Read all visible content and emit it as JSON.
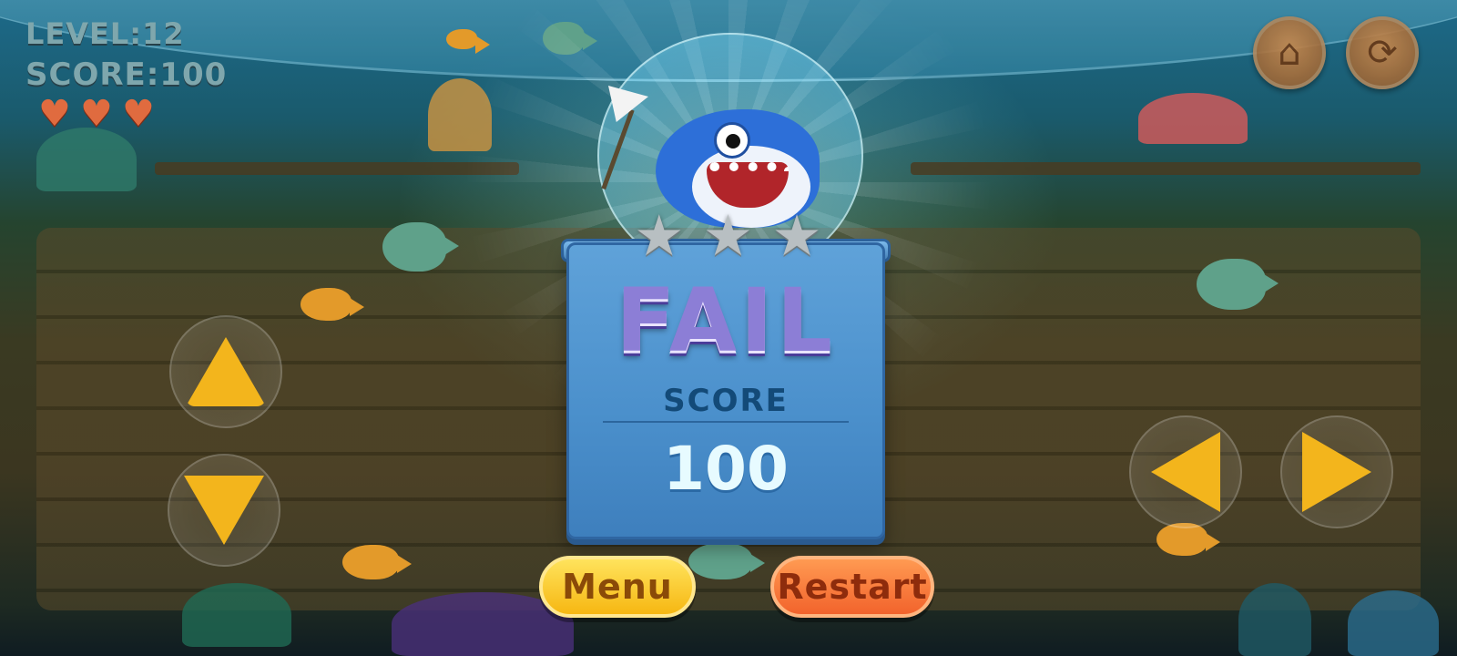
{
  "hud": {
    "level_text": "LEVEL:12",
    "score_text": "SCORE:100",
    "lives": [
      "heart",
      "heart",
      "heart"
    ]
  },
  "top_buttons": {
    "home_icon": "home-icon",
    "refresh_icon": "refresh-icon"
  },
  "result_panel": {
    "title": "FAIL",
    "score_label": "SCORE",
    "score_value": "100",
    "stars_earned": 0,
    "stars_total": 3
  },
  "buttons": {
    "menu_label": "Menu",
    "restart_label": "Restart"
  },
  "controls": [
    "up",
    "down",
    "left",
    "right"
  ],
  "colors": {
    "fail_title": "#8c7ed6",
    "panel": "#4a8fcb",
    "menu_button": "#f6b712",
    "restart_button": "#f2632c",
    "arrow": "#f3b51c",
    "heart": "#e06b3f"
  }
}
